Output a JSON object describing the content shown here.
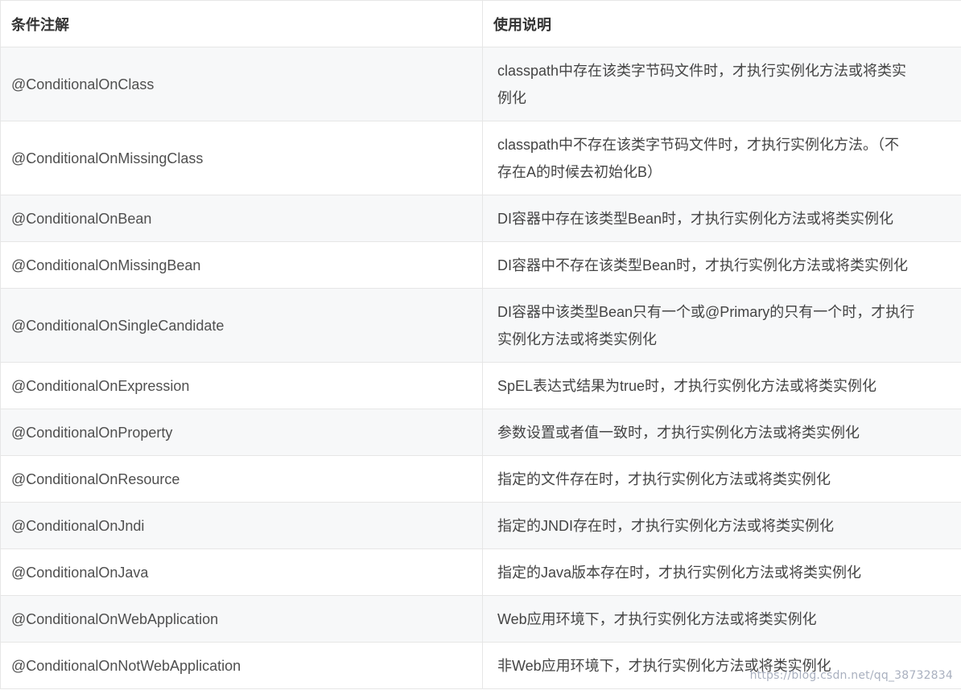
{
  "table": {
    "headers": {
      "annotation": "条件注解",
      "description": "使用说明"
    },
    "rows": [
      {
        "annotation": "@ConditionalOnClass",
        "description": "classpath中存在该类字节码文件时，才执行实例化方法或将类实\n例化"
      },
      {
        "annotation": "@ConditionalOnMissingClass",
        "description": "classpath中不存在该类字节码文件时，才执行实例化方法。（不\n存在A的时候去初始化B）"
      },
      {
        "annotation": "@ConditionalOnBean",
        "description": "DI容器中存在该类型Bean时，才执行实例化方法或将类实例化"
      },
      {
        "annotation": "@ConditionalOnMissingBean",
        "description": "DI容器中不存在该类型Bean时，才执行实例化方法或将类实例化"
      },
      {
        "annotation": "@ConditionalOnSingleCandidate",
        "description": "DI容器中该类型Bean只有一个或@Primary的只有一个时，才执行\n实例化方法或将类实例化"
      },
      {
        "annotation": "@ConditionalOnExpression",
        "description": "SpEL表达式结果为true时，才执行实例化方法或将类实例化"
      },
      {
        "annotation": "@ConditionalOnProperty",
        "description": "参数设置或者值一致时，才执行实例化方法或将类实例化"
      },
      {
        "annotation": "@ConditionalOnResource",
        "description": "指定的文件存在时，才执行实例化方法或将类实例化"
      },
      {
        "annotation": "@ConditionalOnJndi",
        "description": "指定的JNDI存在时，才执行实例化方法或将类实例化"
      },
      {
        "annotation": "@ConditionalOnJava",
        "description": "指定的Java版本存在时，才执行实例化方法或将类实例化"
      },
      {
        "annotation": "@ConditionalOnWebApplication",
        "description": "Web应用环境下，才执行实例化方法或将类实例化"
      },
      {
        "annotation": "@ConditionalOnNotWebApplication",
        "description": "非Web应用环境下，才执行实例化方法或将类实例化"
      }
    ]
  },
  "watermark": "https://blog.csdn.net/qq_38732834"
}
